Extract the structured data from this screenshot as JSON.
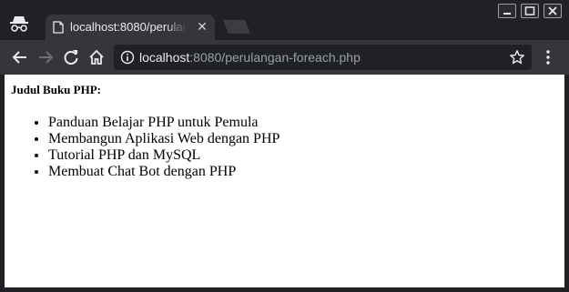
{
  "browser": {
    "tab": {
      "title": "localhost:8080/perulangan-foreach.php"
    },
    "address": {
      "host": "localhost",
      "path": ":8080/perulangan-foreach.php"
    }
  },
  "page": {
    "heading": "Judul Buku PHP:",
    "books": [
      {
        "title": "Panduan Belajar PHP untuk Pemula"
      },
      {
        "title": "Membangun Aplikasi Web dengan PHP"
      },
      {
        "title": "Tutorial PHP dan MySQL"
      },
      {
        "title": "Membuat Chat Bot dengan PHP"
      }
    ]
  },
  "icons": {
    "incognito": "incognito-icon",
    "favicon": "page-icon",
    "tab_close": "close-icon",
    "back": "arrow-left-icon",
    "forward": "arrow-right-icon",
    "reload": "reload-icon",
    "home": "home-icon",
    "info": "info-icon",
    "bookmark": "star-icon",
    "menu": "three-dots-vertical-icon",
    "minimize": "minimize-icon",
    "maximize": "maximize-icon",
    "close_window": "close-icon"
  },
  "colors": {
    "frame": "#202124",
    "toolbar": "#35363a",
    "omnibox": "#202124",
    "page_background": "#ffffff"
  }
}
